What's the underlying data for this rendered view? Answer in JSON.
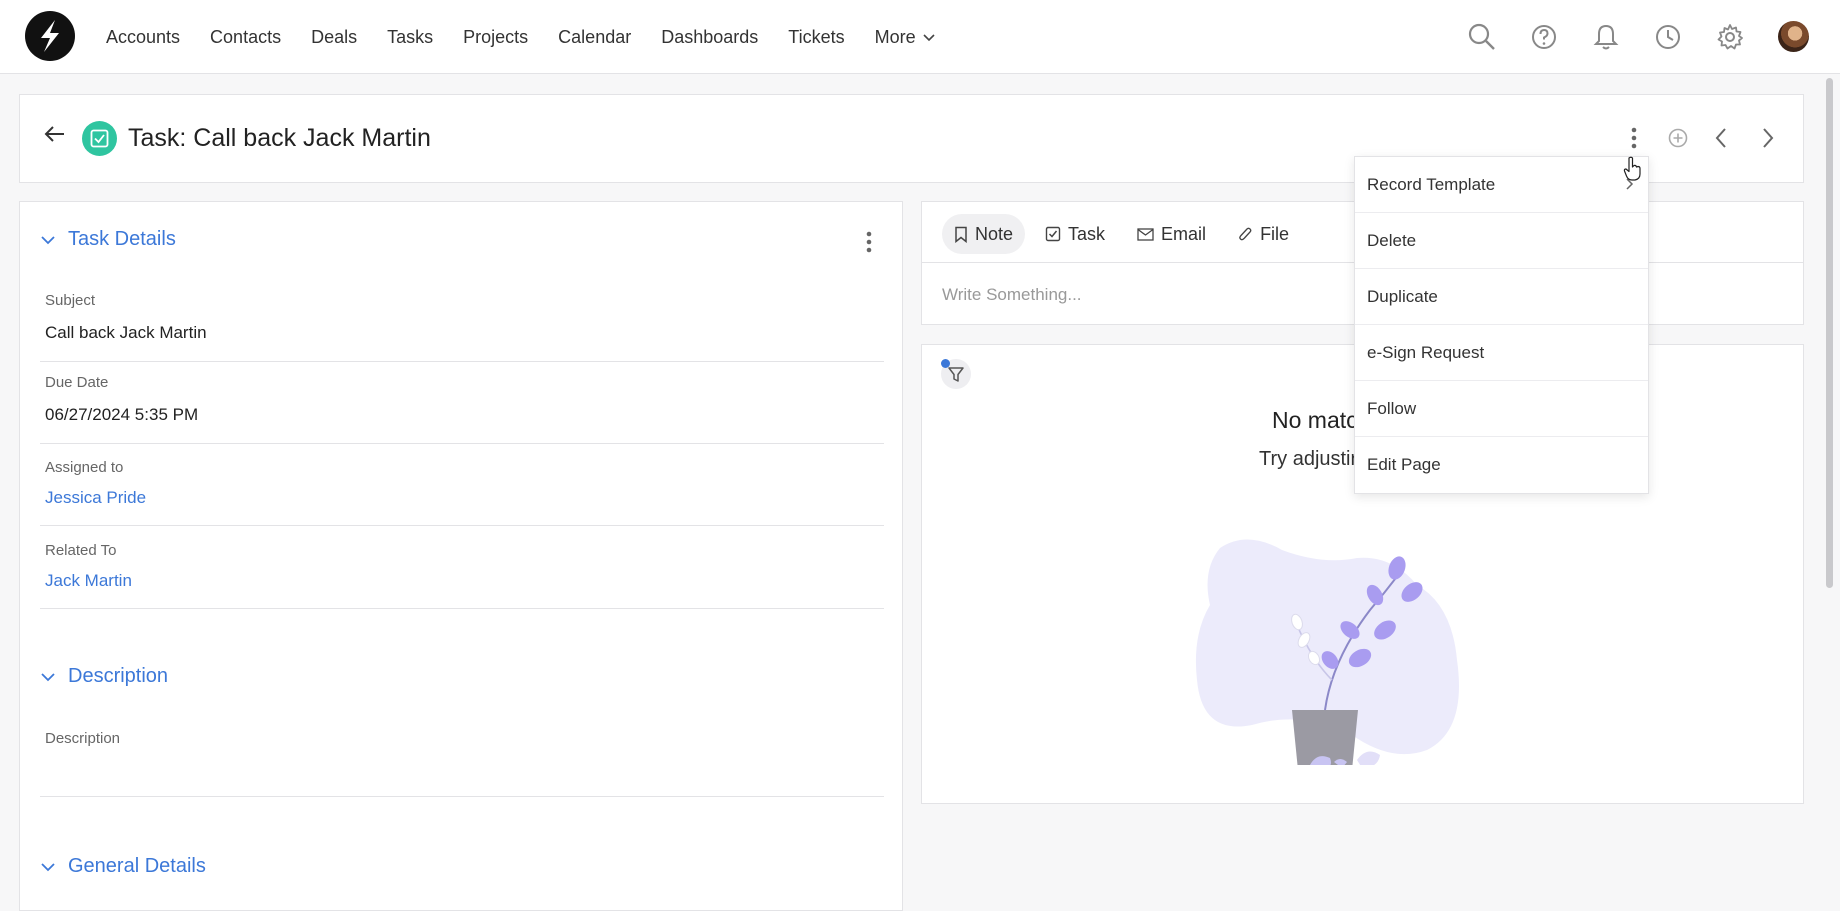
{
  "nav": {
    "items": [
      "Accounts",
      "Contacts",
      "Deals",
      "Tasks",
      "Projects",
      "Calendar",
      "Dashboards",
      "Tickets"
    ],
    "more_label": "More"
  },
  "header": {
    "title": "Task: Call back Jack Martin"
  },
  "task_details": {
    "section_title": "Task Details",
    "fields": [
      {
        "label": "Subject",
        "value": "Call back Jack Martin"
      },
      {
        "label": "Due Date",
        "value": "06/27/2024 5:35 PM"
      },
      {
        "label": "Assigned to",
        "value": "Jessica Pride"
      },
      {
        "label": "Related To",
        "value": "Jack Martin"
      }
    ]
  },
  "description": {
    "section_title": "Description",
    "field_label": "Description"
  },
  "general_details": {
    "section_title": "General Details"
  },
  "composer": {
    "tabs": [
      "Note",
      "Task",
      "Email",
      "File"
    ],
    "placeholder": "Write Something..."
  },
  "timeline": {
    "empty_title": "No matc",
    "empty_subtitle": "Try adjustir"
  },
  "dropdown": {
    "items": [
      "Record Template",
      "Delete",
      "Duplicate",
      "e-Sign Request",
      "Follow",
      "Edit Page"
    ]
  },
  "colors": {
    "accent": "#3c78d8",
    "task_badge": "#2fc5a0",
    "illustration_blob": "#ecebfb",
    "illustration_leaf": "#a99cf0",
    "illustration_pot": "#9b9aa3"
  }
}
